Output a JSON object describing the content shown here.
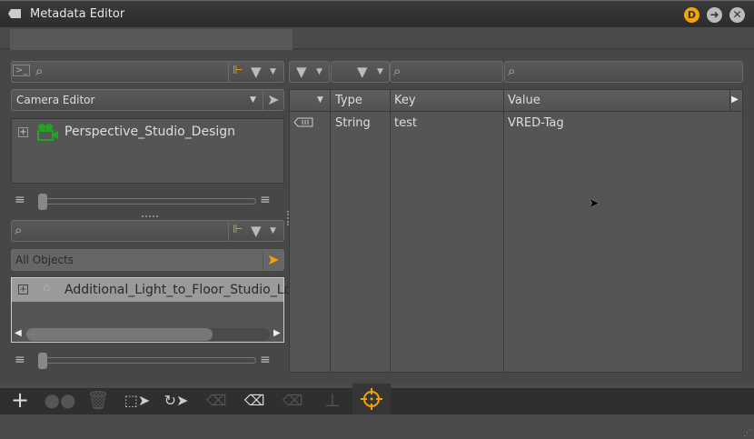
{
  "window": {
    "title": "Metadata Editor"
  },
  "scene_panel": {
    "dropdown": "Camera Editor",
    "tree_item": "Perspective_Studio_Design"
  },
  "object_panel": {
    "dropdown": "All Objects",
    "tree_item": "Additional_Light_to_Floor_Studio_Lo"
  },
  "table": {
    "columns": [
      "Type",
      "Key",
      "Value"
    ],
    "rows": [
      {
        "type": "String",
        "key": "test",
        "value": "VRED-Tag"
      }
    ]
  },
  "colors": {
    "accent": "#f5a300",
    "camera_green": "#1fa51f"
  }
}
